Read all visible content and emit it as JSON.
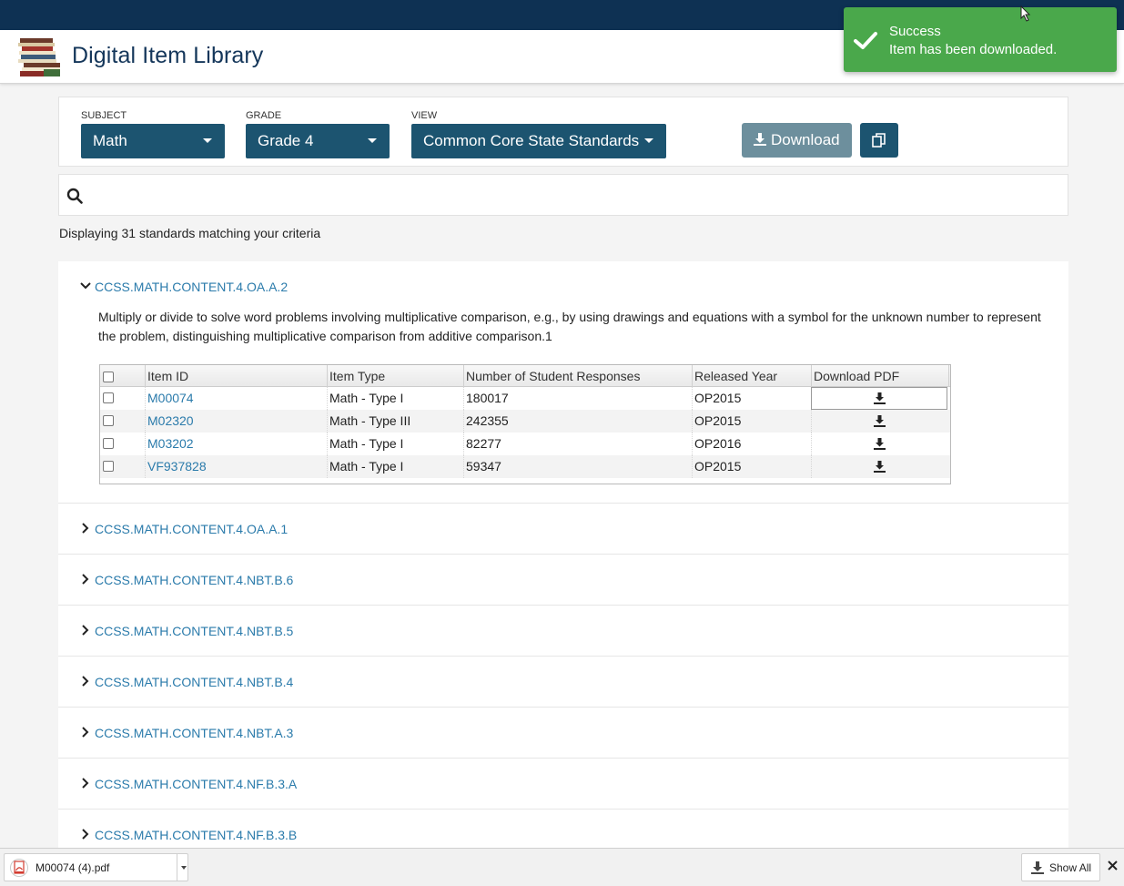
{
  "app": {
    "title": "Digital Item Library"
  },
  "toast": {
    "title": "Success",
    "message": "Item has been downloaded.",
    "color": "#4aa84b"
  },
  "filters": {
    "subject": {
      "label": "SUBJECT",
      "value": "Math"
    },
    "grade": {
      "label": "GRADE",
      "value": "Grade 4"
    },
    "view": {
      "label": "VIEW",
      "value": "Common Core State Standards"
    },
    "download_label": "Download",
    "copy_icon": "copy-icon"
  },
  "search": {
    "placeholder": "",
    "icon": "search-icon"
  },
  "results": {
    "count_text": "Displaying 31 standards matching your criteria"
  },
  "expanded_standard": {
    "code": "CCSS.MATH.CONTENT.4.OA.A.2",
    "description": "Multiply or divide to solve word problems involving multiplicative comparison, e.g., by using drawings and equations with a symbol for the unknown number to represent the problem, distinguishing multiplicative comparison from additive comparison.1",
    "columns": [
      "Item ID",
      "Item Type",
      "Number of Student Responses",
      "Released Year",
      "Download PDF"
    ],
    "items": [
      {
        "id": "M00074",
        "type": "Math - Type I",
        "responses": "180017",
        "year": "OP2015"
      },
      {
        "id": "M02320",
        "type": "Math - Type III",
        "responses": "242355",
        "year": "OP2015"
      },
      {
        "id": "M03202",
        "type": "Math - Type I",
        "responses": "82277",
        "year": "OP2016"
      },
      {
        "id": "VF937828",
        "type": "Math - Type I",
        "responses": "59347",
        "year": "OP2015"
      }
    ]
  },
  "standards": [
    "CCSS.MATH.CONTENT.4.OA.A.1",
    "CCSS.MATH.CONTENT.4.NBT.B.6",
    "CCSS.MATH.CONTENT.4.NBT.B.5",
    "CCSS.MATH.CONTENT.4.NBT.B.4",
    "CCSS.MATH.CONTENT.4.NBT.A.3",
    "CCSS.MATH.CONTENT.4.NF.B.3.A",
    "CCSS.MATH.CONTENT.4.NF.B.3.B"
  ],
  "download_bar": {
    "file_name": "M00074 (4).pdf",
    "show_all_label": "Show All"
  },
  "colors": {
    "nav": "#0e3153",
    "accent": "#1c5470",
    "link": "#2b7bab",
    "download_button": "#6d8f9d"
  }
}
